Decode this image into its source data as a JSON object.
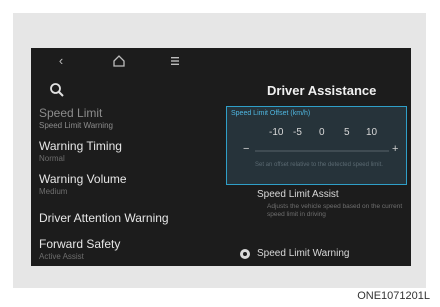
{
  "nav": {
    "back_icon": "chevron-left-icon",
    "home_icon": "home-icon",
    "menu_icon": "menu-icon"
  },
  "search_icon": "search-icon",
  "left_menu": [
    {
      "title": "Speed Limit",
      "sub": "Speed Limit Warning"
    },
    {
      "title": "Warning Timing",
      "sub": "Normal"
    },
    {
      "title": "Warning Volume",
      "sub": "Medium"
    },
    {
      "title": "Driver Attention Warning",
      "sub": ""
    },
    {
      "title": "Forward Safety",
      "sub": "Active Assist"
    }
  ],
  "right": {
    "title": "Driver Assistance",
    "offset": {
      "label": "Speed Limit Offset (km/h)",
      "scale": [
        "-10",
        "-5",
        "0",
        "5",
        "10"
      ],
      "minus": "−",
      "plus": "+",
      "desc": "Set an offset relative to the detected speed limit."
    },
    "options": [
      {
        "title": "Speed Limit Assist",
        "desc": "Adjusts the vehicle speed based on the current speed limit in driving",
        "selected": false
      },
      {
        "title": "Speed Limit Warning",
        "desc": "",
        "selected": true
      }
    ]
  },
  "caption": "ONE1071201L",
  "colors": {
    "accent": "#2f9fc8",
    "screen_bg": "#1c1c1c"
  }
}
